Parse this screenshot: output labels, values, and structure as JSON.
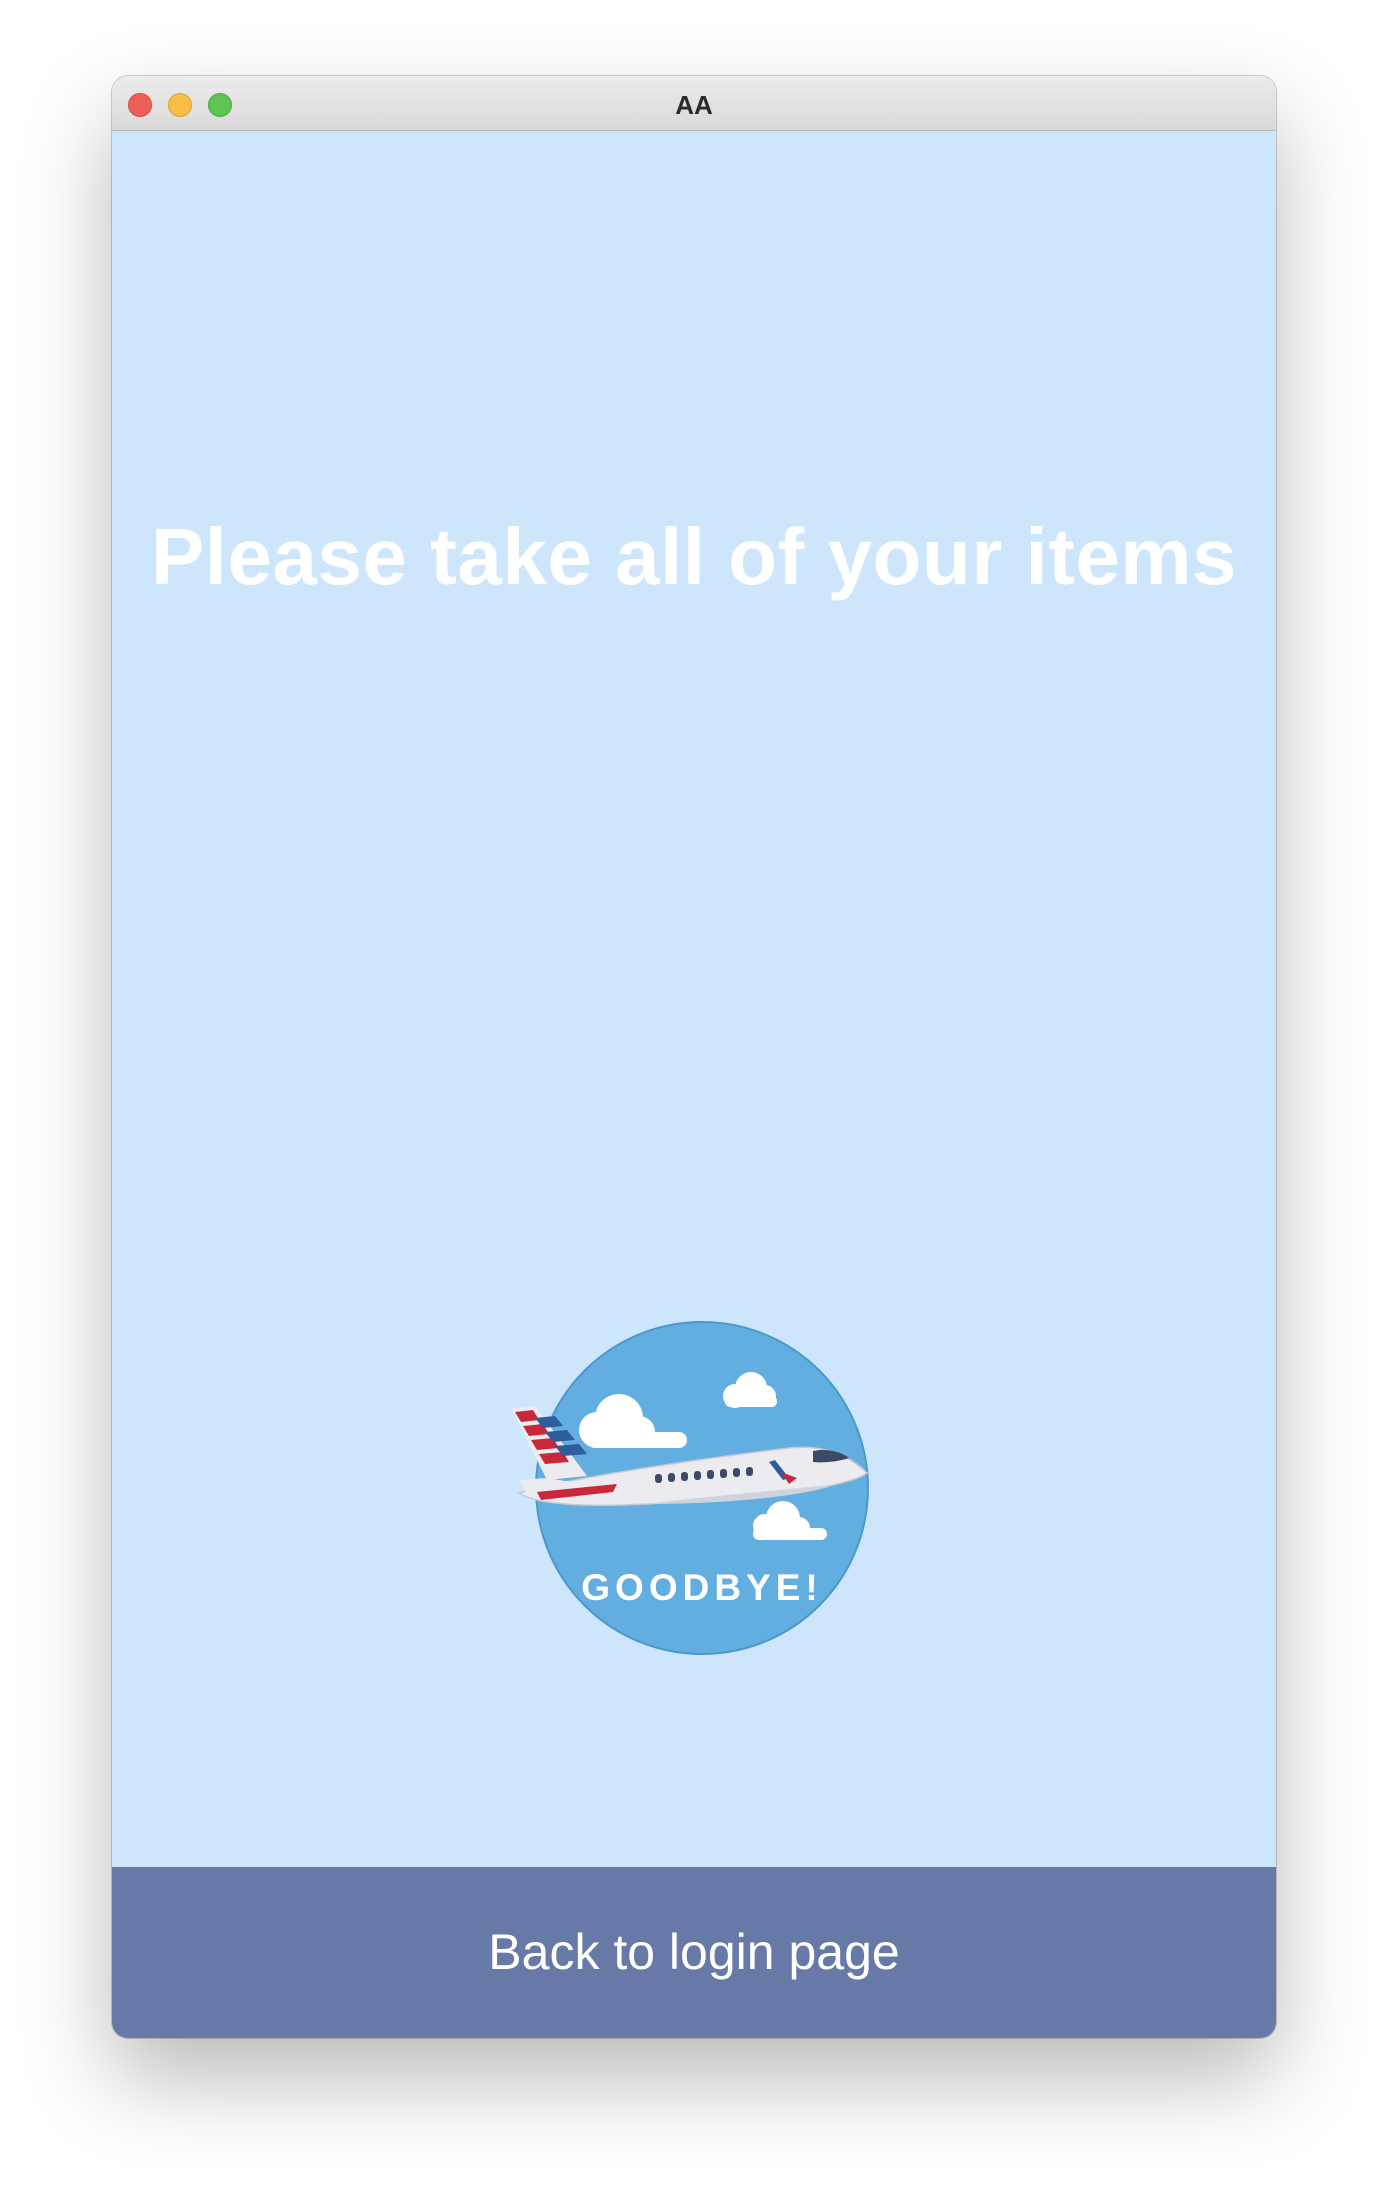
{
  "window": {
    "title": "AA"
  },
  "main": {
    "heading": "Please take all of your items",
    "badge_text": "GOODBYE!",
    "badge_icon": "airplane-goodbye-icon"
  },
  "footer": {
    "button_label": "Back to login page"
  },
  "colors": {
    "background": "#cde6fb",
    "badge_circle": "#62aee0",
    "button": "#6779a6",
    "text": "#ffffff"
  }
}
